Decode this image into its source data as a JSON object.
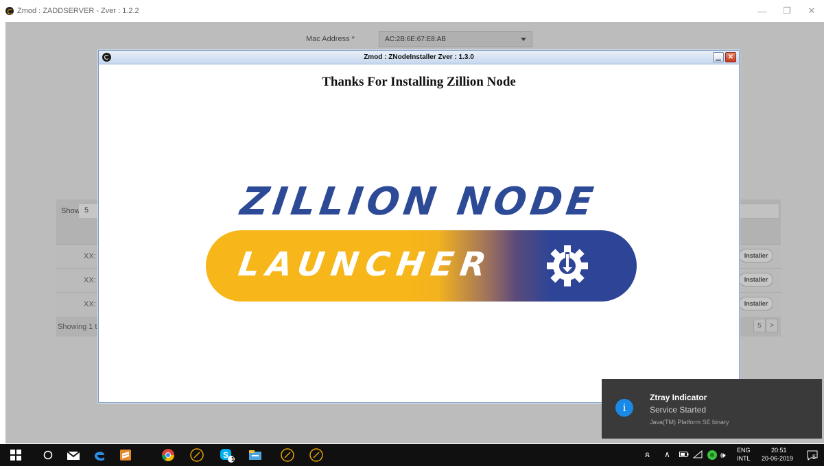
{
  "window": {
    "title": "Zmod : ZADDSERVER - Zver : 1.2.2",
    "minimize": "—",
    "maximize": "❐",
    "close": "✕"
  },
  "form": {
    "mac_label": "Mac Address *",
    "mac_value": "AC:2B:6E:67:E8:AB"
  },
  "table": {
    "show_label": "Show",
    "show_value": "5",
    "rows": [
      {
        "cell": "XX:",
        "action": "Installer"
      },
      {
        "cell": "XX:",
        "action": "Installer"
      },
      {
        "cell": "XX:",
        "action": "Installer"
      }
    ],
    "showing_text": "Showing 1 t",
    "pages": [
      "5",
      ">"
    ]
  },
  "dialog": {
    "title": "Zmod : ZNodeInstaller Zver : 1.3.0",
    "heading": "Thanks For Installing Zillion Node",
    "logo_title": "ZILLION NODE",
    "logo_sub": "LAUNCHER",
    "colors": {
      "blue": "#2c4a95",
      "yellow": "#f7b61a"
    }
  },
  "toast": {
    "title": "Ztray Indicator",
    "message": "Service Started",
    "source": "Java(TM) Platform SE binary"
  },
  "taskbar": {
    "icons": [
      "windows-start-icon",
      "search-circle-icon",
      "mail-icon",
      "edge-icon",
      "sublime-icon",
      "chrome-icon",
      "zmod-icon",
      "skype-icon",
      "file-explorer-icon",
      "zmod-icon",
      "zmod-icon"
    ],
    "skype_badge": "1",
    "lang_top": "ENG",
    "lang_bottom": "INTL",
    "time": "20:51",
    "date": "20-06-2019",
    "notification_count": "5"
  }
}
